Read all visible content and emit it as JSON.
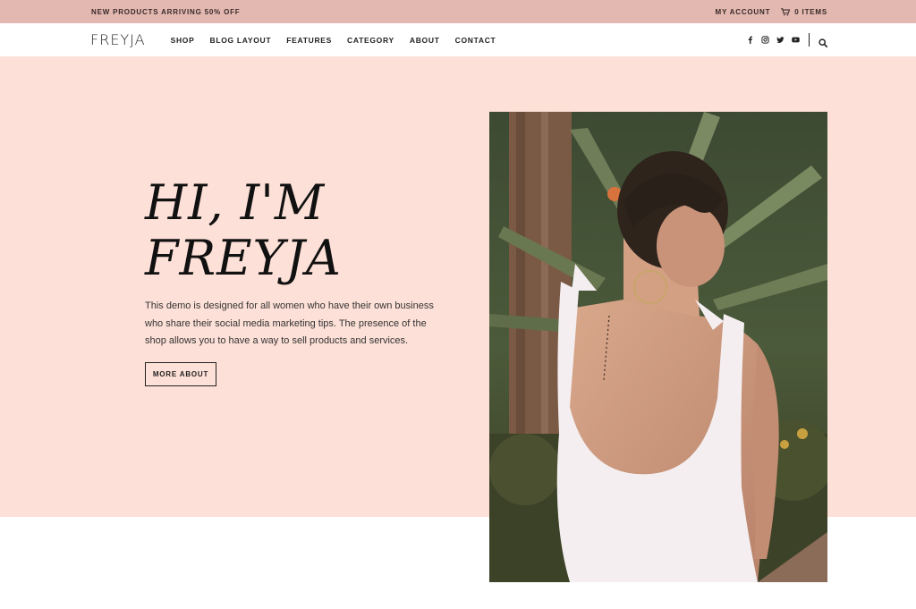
{
  "topbar": {
    "promo": "NEW PRODUCTS ARRIVING 50% OFF",
    "account": "MY ACCOUNT",
    "cart": "0 ITEMS"
  },
  "nav": {
    "logo": "FREYJA",
    "items": [
      "SHOP",
      "BLOG LAYOUT",
      "FEATURES",
      "CATEGORY",
      "ABOUT",
      "CONTACT"
    ],
    "social_icons": [
      "facebook-icon",
      "instagram-icon",
      "twitter-icon",
      "youtube-icon"
    ]
  },
  "hero": {
    "title_line1": "HI, I'M",
    "title_line2": "FREYJA",
    "description": "This demo is designed for all women who have their own business who share their social media marketing tips. The presence of the shop allows you to have a way to sell products and services.",
    "button": "MORE ABOUT"
  },
  "colors": {
    "topbar_bg": "#e2b8b1",
    "hero_bg": "#fde0d7",
    "text": "#1a1a1a"
  }
}
